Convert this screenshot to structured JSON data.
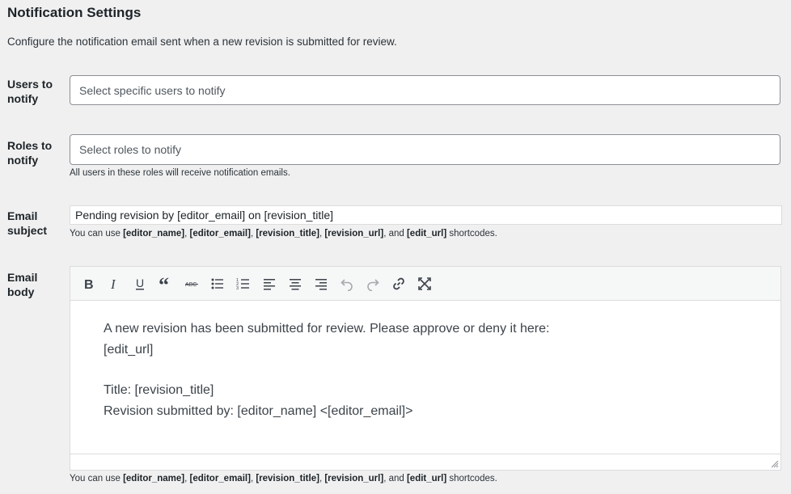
{
  "page": {
    "title": "Notification Settings",
    "intro": "Configure the notification email sent when a new revision is submitted for review."
  },
  "users": {
    "label": "Users to notify",
    "placeholder": "Select specific users to notify"
  },
  "roles": {
    "label": "Roles to notify",
    "placeholder": "Select roles to notify",
    "help": "All users in these roles will receive notification emails."
  },
  "subject": {
    "label": "Email subject",
    "value": "Pending revision by [editor_email] on [revision_title]",
    "help_prefix": "You can use ",
    "shortcodes": [
      "[editor_name]",
      "[editor_email]",
      "[revision_title]",
      "[revision_url]",
      "[edit_url]"
    ],
    "sep": ", ",
    "and": ", and ",
    "help_suffix": " shortcodes."
  },
  "body": {
    "label": "Email body",
    "toolbar": [
      "bold-icon",
      "italic-icon",
      "underline-icon",
      "blockquote-icon",
      "strikethrough-icon",
      "bullet-list-icon",
      "numbered-list-icon",
      "align-left-icon",
      "align-center-icon",
      "align-right-icon",
      "undo-icon",
      "redo-icon",
      "link-icon",
      "fullscreen-icon"
    ],
    "line1": "A new revision has been submitted for review. Please approve or deny it here:",
    "line2": "[edit_url]",
    "line3": "Title: [revision_title]",
    "line4": "Revision submitted by: [editor_name] <[editor_email]>"
  }
}
